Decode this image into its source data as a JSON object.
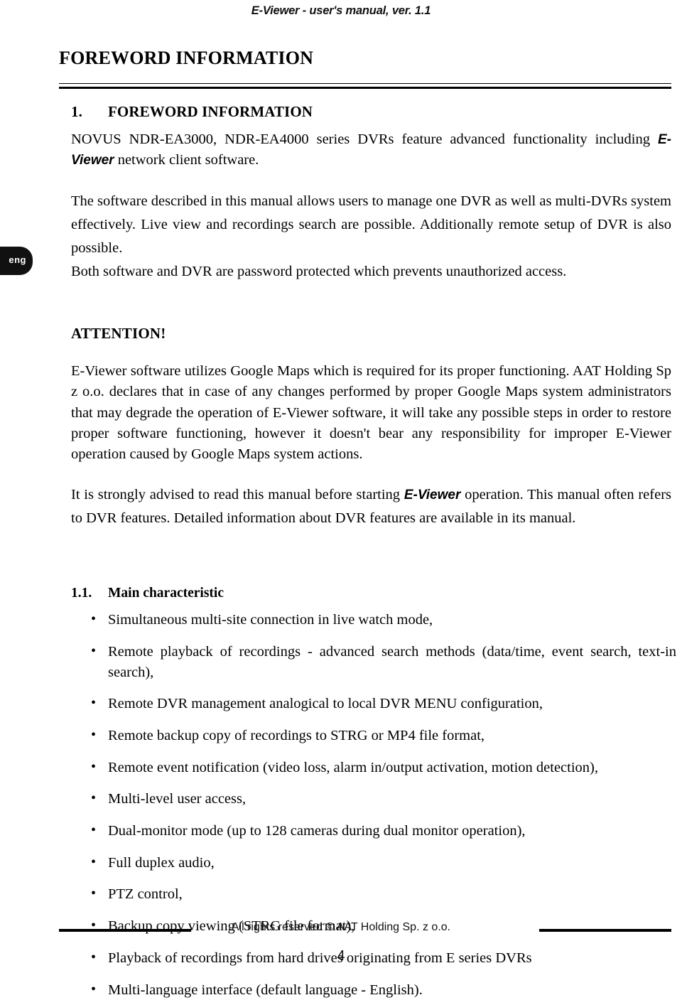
{
  "header": {
    "running_title": "E-Viewer - user's manual, ver. 1.1"
  },
  "language_tab": {
    "label": "eng"
  },
  "document": {
    "title": "FOREWORD INFORMATION",
    "section": {
      "number": "1.",
      "title": "FOREWORD INFORMATION"
    },
    "paragraphs": {
      "intro_part1": "NOVUS NDR-EA3000, NDR-EA4000 series DVRs feature advanced functionality including ",
      "intro_brand": "E-Viewer",
      "intro_part2": " network client software.",
      "overview": "The software described in this manual allows users to manage one DVR as well as multi-DVRs system effectively. Live view and recordings search are possible. Additionally remote setup of DVR is also possible.",
      "password": "Both software and DVR are password protected which prevents unauthorized access.",
      "attention_title": "ATTENTION!",
      "attention_body": "E-Viewer software utilizes Google Maps which is required for its proper functioning. AAT Holding Sp z o.o. declares that in case of any changes performed by proper Google Maps system administrators that may degrade the operation of E-Viewer software, it will take any possible steps in order to restore proper software functioning, however it doesn't bear any responsibility for improper E-Viewer operation caused by Google Maps system actions.",
      "advice_part1": "It is strongly advised to read this manual before starting ",
      "advice_brand": "E-Viewer",
      "advice_part2": " operation. This manual often refers to DVR features. Detailed information about DVR features are available in its manual."
    },
    "subsection": {
      "number": "1.1.",
      "title": "Main characteristic"
    },
    "features": [
      "Simultaneous multi-site connection in live watch mode,",
      "Remote playback of recordings - advanced search methods (data/time, event search, text-in search),",
      "Remote DVR management analogical to local DVR MENU configuration,",
      "Remote backup copy of recordings to STRG or MP4 file format,",
      "Remote event notification (video loss, alarm in/output activation, motion detection),",
      "Multi-level user access,",
      "Dual-monitor mode (up to 128 cameras during dual monitor operation),",
      "Full duplex audio,",
      "PTZ control,",
      "Backup copy viewing (STRG file format),",
      "Playback of recordings from hard drives originating from E series DVRs",
      "Multi-language interface (default language - English)."
    ],
    "bullet_glyph": "•"
  },
  "footer": {
    "copyright": "All rights reserved © AAT Holding Sp. z o.o.",
    "page_number": "4"
  }
}
